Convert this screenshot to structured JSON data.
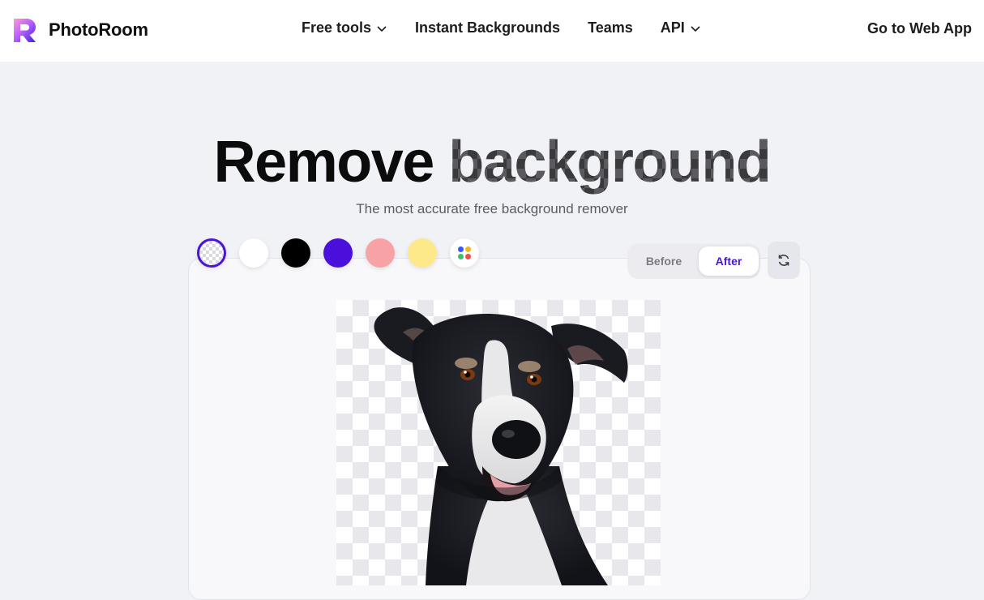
{
  "brand": {
    "name": "PhotoRoom"
  },
  "nav": {
    "items": [
      {
        "label": "Free tools",
        "has_dropdown": true
      },
      {
        "label": "Instant Backgrounds",
        "has_dropdown": false
      },
      {
        "label": "Teams",
        "has_dropdown": false
      },
      {
        "label": "API",
        "has_dropdown": true
      }
    ],
    "cta": "Go to Web App"
  },
  "hero": {
    "title_part1": "Remove",
    "title_part2": "background",
    "subtitle": "The most accurate free background remover"
  },
  "swatches": [
    {
      "name": "transparent",
      "color": "transparent",
      "selected": true
    },
    {
      "name": "white",
      "color": "#ffffff",
      "selected": false
    },
    {
      "name": "black",
      "color": "#000000",
      "selected": false
    },
    {
      "name": "purple",
      "color": "#4a0fdb",
      "selected": false
    },
    {
      "name": "pink",
      "color": "#f7a3a6",
      "selected": false
    },
    {
      "name": "yellow",
      "color": "#fde98a",
      "selected": false
    },
    {
      "name": "more-colors",
      "color": "multi",
      "selected": false
    }
  ],
  "multi_dots": [
    "#2f5cf6",
    "#f2b623",
    "#3cbf6a",
    "#ef4b4b"
  ],
  "toggle": {
    "before": "Before",
    "after": "After",
    "active": "After"
  },
  "colors": {
    "accent": "#4a16d6",
    "background": "#f1f2f6",
    "header": "#ffffff"
  },
  "icons": {
    "refresh": "refresh-icon",
    "chevron": "chevron-down-icon"
  }
}
